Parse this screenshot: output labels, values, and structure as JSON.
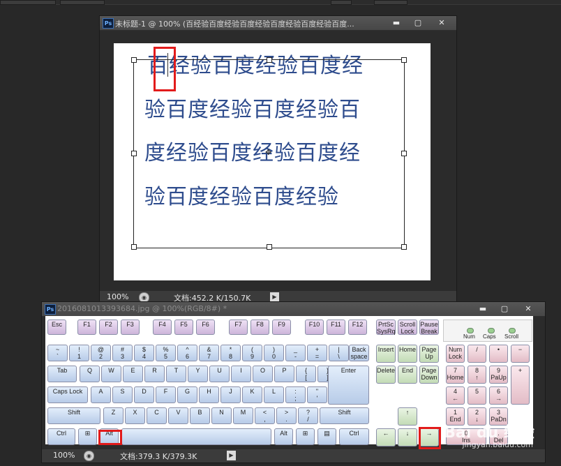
{
  "window1": {
    "title": "未标题-1 @ 100% (百经验百度经验百度经验百度经验百度经验百度...",
    "zoom": "100%",
    "doc_size": "文档:452.2 K/150.7K",
    "text_lines": [
      "百经验百度经验百度经",
      "验百度经验百度经验百",
      "度经验百度经验百度经",
      "验百度经验百度经验"
    ]
  },
  "window2": {
    "title": "2016081013393684.jpg @ 100%(RGB/8#) *",
    "zoom": "100%",
    "doc_size": "文档:379.3 K/379.3K"
  },
  "window_buttons": {
    "minimize": "▬",
    "maximize": "▢",
    "close": "✕"
  },
  "ps_icon": "Ps",
  "keyboard": {
    "function_row": [
      "Esc",
      "F1",
      "F2",
      "F3",
      "F4",
      "F5",
      "F6",
      "F7",
      "F8",
      "F9",
      "F10",
      "F11",
      "F12"
    ],
    "system_keys": [
      "PrtSc SysRq",
      "Scroll Lock",
      "Pause Break"
    ],
    "leds": [
      "Num",
      "Caps",
      "Scroll"
    ],
    "number_row": [
      [
        "~",
        "`"
      ],
      [
        "!",
        "1"
      ],
      [
        "@",
        "2"
      ],
      [
        "#",
        "3"
      ],
      [
        "$",
        "4"
      ],
      [
        "%",
        "5"
      ],
      [
        "^",
        "6"
      ],
      [
        "&",
        "7"
      ],
      [
        "*",
        "8"
      ],
      [
        "(",
        "9"
      ],
      [
        ")",
        "0"
      ],
      [
        "_",
        "-"
      ],
      [
        "+",
        "="
      ],
      [
        "|",
        "\\"
      ]
    ],
    "backspace": "Back space",
    "tab": "Tab",
    "qrow": [
      "Q",
      "W",
      "E",
      "R",
      "T",
      "Y",
      "U",
      "I",
      "O",
      "P"
    ],
    "qrow_brackets": [
      [
        "{",
        "["
      ],
      [
        "}",
        "]"
      ]
    ],
    "caps": "Caps Lock",
    "arow": [
      "A",
      "S",
      "D",
      "F",
      "G",
      "H",
      "J",
      "K",
      "L"
    ],
    "arow_punct": [
      [
        ":",
        ";"
      ],
      [
        "\"",
        "'"
      ]
    ],
    "enter": "Enter",
    "shift": "Shift",
    "zrow": [
      "Z",
      "X",
      "C",
      "V",
      "B",
      "N",
      "M"
    ],
    "zrow_punct": [
      [
        "<",
        ","
      ],
      [
        ">",
        "."
      ],
      [
        "?",
        "/"
      ]
    ],
    "ctrl": "Ctrl",
    "alt": "Alt",
    "nav": [
      "Insert",
      "Home",
      "Page Up",
      "Delete",
      "End",
      "Page Down"
    ],
    "arrows": {
      "up": "↑",
      "left": "←",
      "down": "↓",
      "right": "→"
    },
    "numpad": {
      "row1": [
        "Num Lock",
        "/",
        "•",
        "−"
      ],
      "row2": [
        [
          "7",
          "Home"
        ],
        [
          "8",
          "↑"
        ],
        [
          "9",
          "PaUp"
        ]
      ],
      "plus": "+",
      "row3": [
        [
          "4",
          "←"
        ],
        [
          "5",
          ""
        ],
        [
          "6",
          "→"
        ]
      ],
      "row4": [
        [
          "1",
          "End"
        ],
        [
          "2",
          "↓"
        ],
        [
          "3",
          "PaDn"
        ]
      ],
      "row5": [
        [
          "0",
          "Ins"
        ],
        [
          ".",
          "Del"
        ]
      ]
    }
  },
  "watermark": {
    "brand": "Bai du 经验",
    "url": "jingyan.baidu.com"
  }
}
